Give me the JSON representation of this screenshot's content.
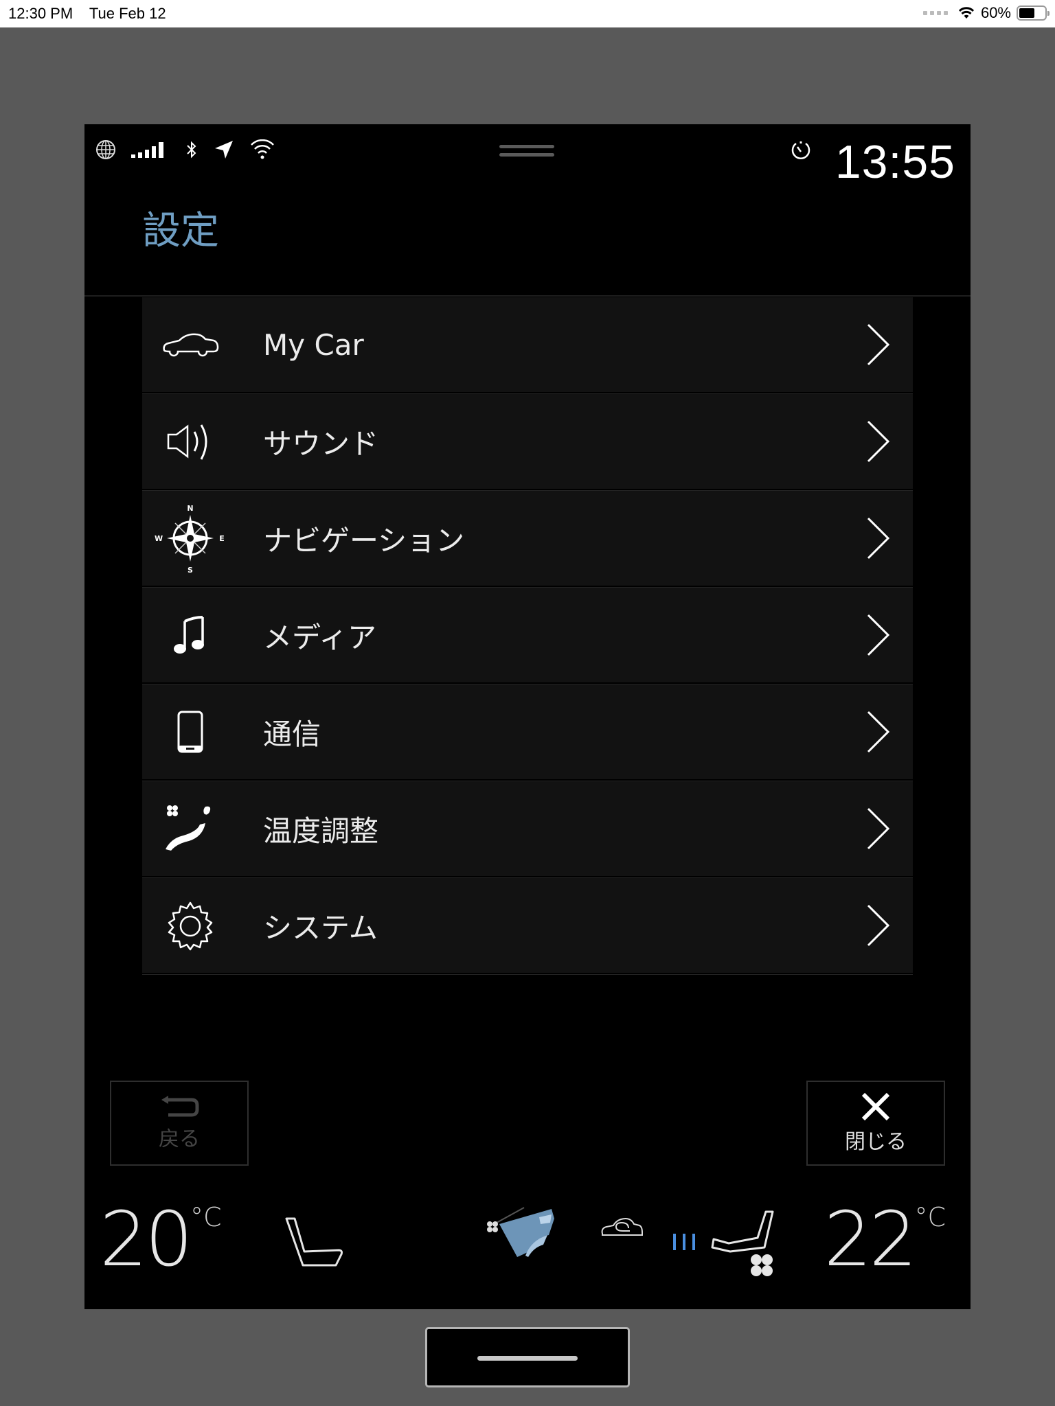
{
  "ios_status": {
    "time": "12:30 PM",
    "date": "Tue Feb 12",
    "battery": "60%",
    "battery_level": 0.6
  },
  "car_status": {
    "icons": [
      "globe-icon",
      "signal-icon",
      "bluetooth-icon",
      "location-arrow-icon",
      "wifi-icon"
    ],
    "timer_icon": "timer-icon",
    "clock": "13:55"
  },
  "header": {
    "title": "設定"
  },
  "menu": {
    "items": [
      {
        "label": "My Car",
        "icon": "car-icon"
      },
      {
        "label": "サウンド",
        "icon": "speaker-icon"
      },
      {
        "label": "ナビゲーション",
        "icon": "compass-icon"
      },
      {
        "label": "メディア",
        "icon": "music-note-icon"
      },
      {
        "label": "通信",
        "icon": "smartphone-icon"
      },
      {
        "label": "温度調整",
        "icon": "climate-icon"
      },
      {
        "label": "システム",
        "icon": "gear-icon"
      }
    ]
  },
  "buttons": {
    "back_label": "戻る",
    "close_label": "閉じる"
  },
  "climate": {
    "left_temp": "20",
    "right_temp": "22",
    "unit": "°C",
    "fan_level": 3,
    "accent_color": "#4a8fe0"
  },
  "compass_labels": {
    "n": "N",
    "s": "S",
    "e": "E",
    "w": "W"
  }
}
